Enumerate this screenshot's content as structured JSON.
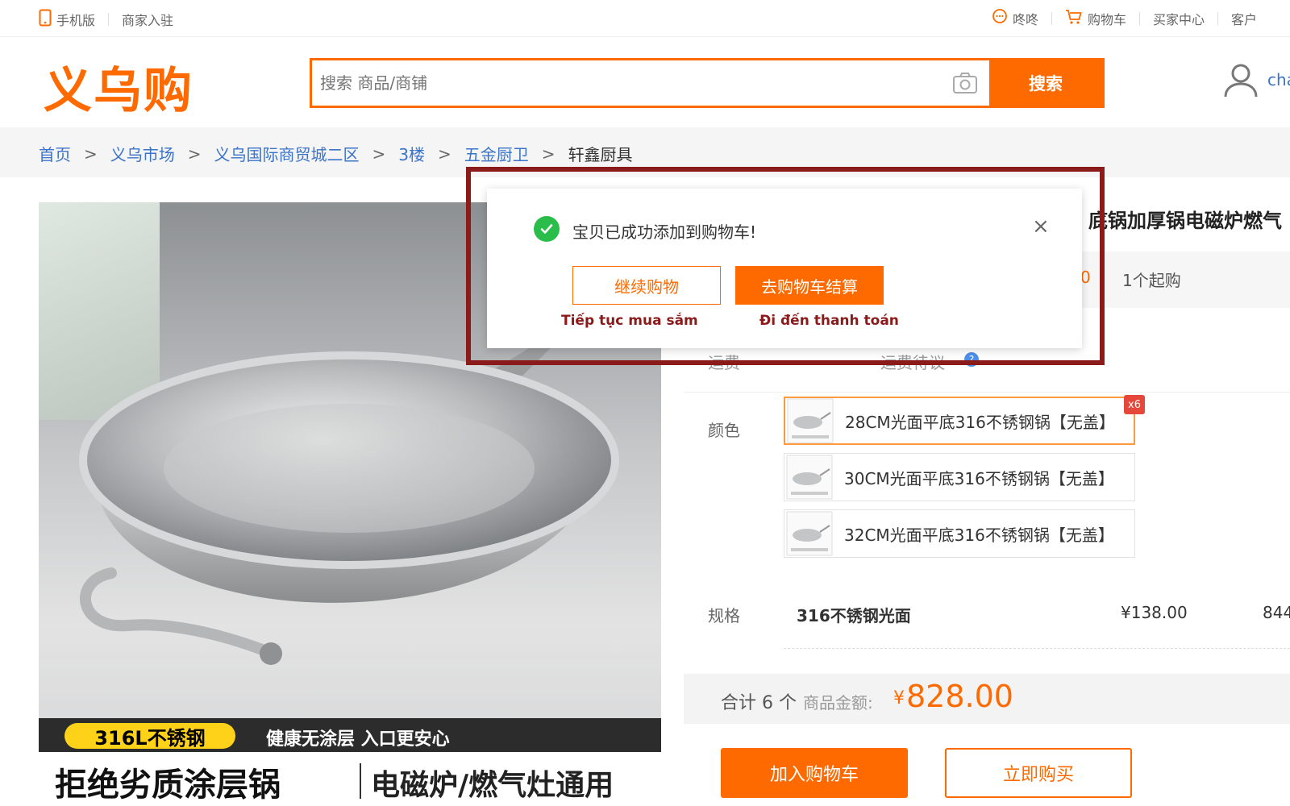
{
  "colors": {
    "accent": "#ff6a00",
    "link": "#3a73c9",
    "highlight": "#8b1a1a",
    "success": "#2bbd4a"
  },
  "topbar": {
    "mobile": "手机版",
    "merchant": "商家入驻",
    "dongdong": "咚咚",
    "cart": "购物车",
    "buyer_center": "买家中心",
    "service": "客户"
  },
  "header": {
    "logo": "义乌购",
    "search_placeholder": "搜索 商品/商铺",
    "search_button": "搜索",
    "user_name": "cha"
  },
  "breadcrumb": {
    "items": [
      "首页",
      "义乌市场",
      "义乌国际商贸城二区",
      "3楼",
      "五金厨卫"
    ],
    "current": "轩鑫厨具",
    "separator": ">"
  },
  "product_image": {
    "tag": "316L不锈钢",
    "strip_text": "健康无涂层 入口更安心",
    "slogan_left": "拒绝劣质涂层锅",
    "slogan_right": "电磁炉/燃气灶通用"
  },
  "product": {
    "title_fragment": "底锅加厚锅电磁炉燃气",
    "price_fragment": "0",
    "min_order": "1个起购",
    "shipping_label": "运费",
    "shipping_value": "运费待议",
    "color_label": "颜色",
    "options": [
      "28CM光面平底316不锈钢锅【无盖】",
      "30CM光面平底316不锈钢锅【无盖】",
      "32CM光面平底316不锈钢锅【无盖】"
    ],
    "selected_badge": "x6",
    "spec_label": "规格",
    "spec_name": "316不锈钢光面",
    "spec_price": "¥138.00",
    "spec_stock": "844"
  },
  "total": {
    "count": "合计 6 个",
    "amount_label": "商品金额:",
    "currency": "¥",
    "amount": "828.00"
  },
  "actions": {
    "add_to_cart": "加入购物车",
    "buy_now": "立即购买"
  },
  "modal": {
    "message": "宝贝已成功添加到购物车!",
    "continue_button": "继续购物",
    "checkout_button": "去购物车结算",
    "continue_caption": "Tiếp tục mua sắm",
    "checkout_caption": "Đi đến thanh toán",
    "close": "×"
  }
}
